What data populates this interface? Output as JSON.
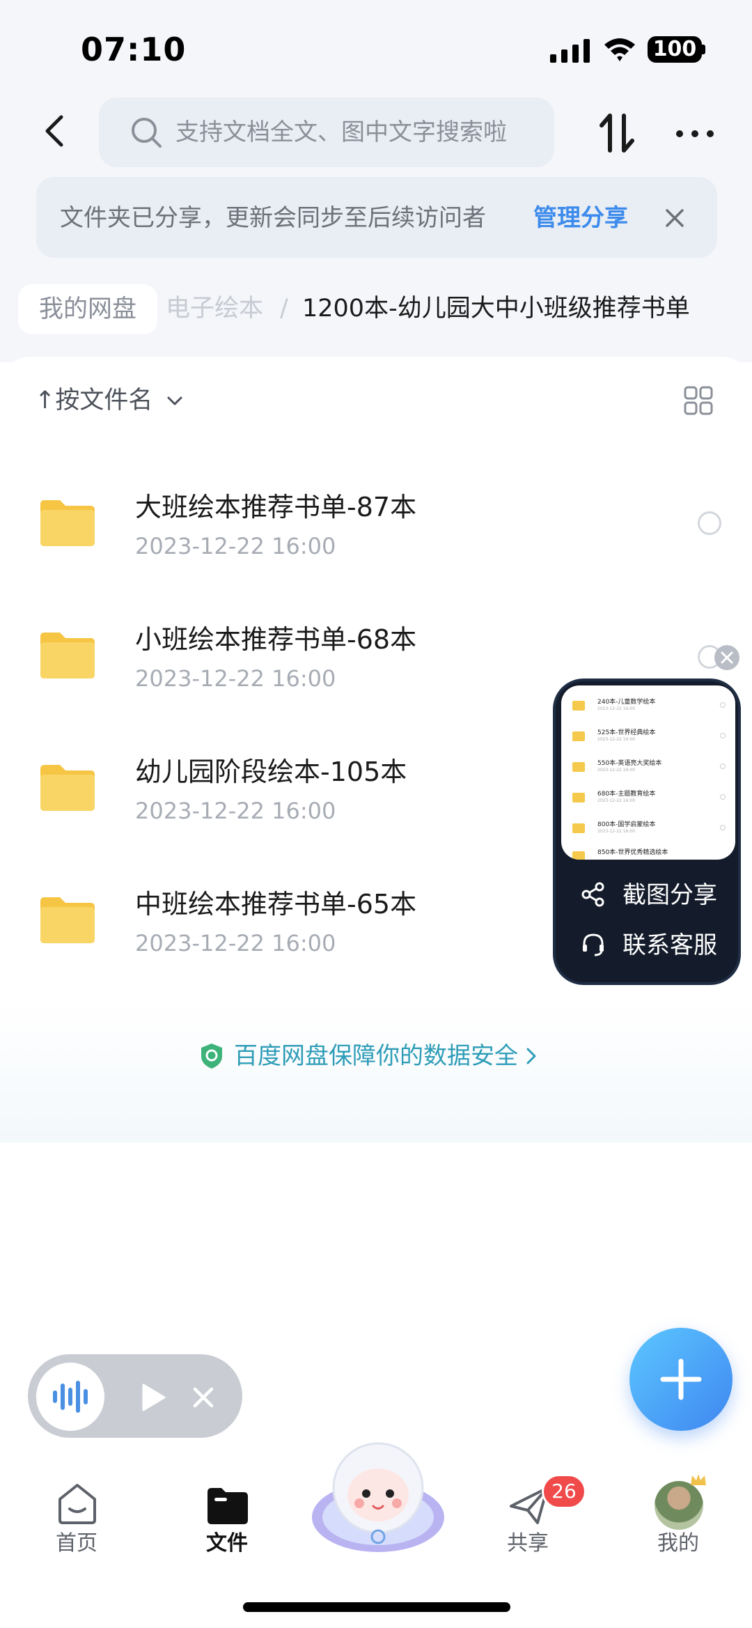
{
  "status_bar": {
    "time": "07:10",
    "battery": "100"
  },
  "header": {
    "search_placeholder": "支持文档全文、图中文字搜索啦"
  },
  "notice": {
    "text": "文件夹已分享，更新会同步至后续访问者",
    "action": "管理分享"
  },
  "breadcrumb": {
    "root": "我的网盘",
    "parent": "电子绘本",
    "separator": "/",
    "current": "1200本-幼儿园大中小班级推荐书单"
  },
  "toolbar": {
    "sort_label": "↑按文件名"
  },
  "files": [
    {
      "name": "大班绘本推荐书单-87本",
      "date": "2023-12-22 16:00"
    },
    {
      "name": "小班绘本推荐书单-68本",
      "date": "2023-12-22 16:00"
    },
    {
      "name": "幼儿园阶段绘本-105本",
      "date": "2023-12-22 16:00"
    },
    {
      "name": "中班绘本推荐书单-65本",
      "date": "2023-12-22 16:00"
    }
  ],
  "floating_panel": {
    "thumbnail_items": [
      {
        "name": "240本-儿童数学绘本",
        "date": "2023-12-22 16:00"
      },
      {
        "name": "525本-世界经典绘本",
        "date": "2023-12-22 16:00"
      },
      {
        "name": "550本-英语亮大奖绘本",
        "date": "2023-12-22 16:00"
      },
      {
        "name": "680本-主题教育绘本",
        "date": "2023-12-22 16:00"
      },
      {
        "name": "800本-国学启蒙绘本",
        "date": "2023-12-22 16:00"
      },
      {
        "name": "850本-世界优秀精选绘本",
        "date": ""
      }
    ],
    "share_label": "截图分享",
    "support_label": "联系客服"
  },
  "security": {
    "text": "百度网盘保障你的数据安全"
  },
  "tabbar": {
    "home": "首页",
    "files": "文件",
    "share": "共享",
    "share_badge": "26",
    "me": "我的"
  },
  "colors": {
    "accent": "#3c8bec",
    "security": "#2f9db8",
    "folder": "#f6c544",
    "badge": "#f04a4a",
    "fab": "#4a9ff5"
  }
}
